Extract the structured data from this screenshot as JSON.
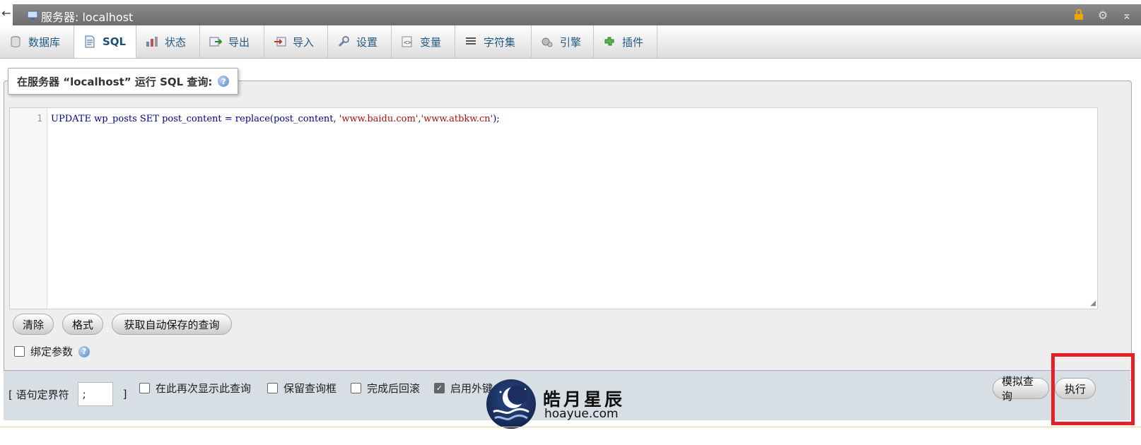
{
  "titlebar": {
    "back_icon": "←",
    "title": "服务器: localhost"
  },
  "tabs": [
    {
      "label": "数据库",
      "icon": "database-icon"
    },
    {
      "label": "SQL",
      "icon": "sql-icon",
      "active": true
    },
    {
      "label": "状态",
      "icon": "status-icon"
    },
    {
      "label": "导出",
      "icon": "export-icon"
    },
    {
      "label": "导入",
      "icon": "import-icon"
    },
    {
      "label": "设置",
      "icon": "wrench-icon"
    },
    {
      "label": "变量",
      "icon": "variables-icon"
    },
    {
      "label": "字符集",
      "icon": "charset-icon"
    },
    {
      "label": "引擎",
      "icon": "engine-icon"
    },
    {
      "label": "插件",
      "icon": "plugin-icon"
    }
  ],
  "query": {
    "legend": "在服务器 “localhost” 运行 SQL 查询:",
    "line_number": "1",
    "code_prefix": "UPDATE wp_posts SET post_content = replace(post_content, ",
    "code_str1": "'www.baidu.com'",
    "code_comma": ",",
    "code_str2": "'www.atbkw.cn'",
    "code_suffix": ");"
  },
  "buttons": {
    "clear": "清除",
    "format": "格式",
    "get_autosaved": "获取自动保存的查询"
  },
  "bind_params": "绑定参数",
  "footer": {
    "delimiter_open": "[ 语句定界符",
    "delimiter_value": ";",
    "delimiter_close": "]",
    "show_again": "在此再次显示此查询",
    "keep_box": "保留查询框",
    "rollback": "完成后回滚",
    "foreign_keys": "启用外键",
    "simulate": "模拟查询",
    "go": "执行"
  },
  "watermark": {
    "cn": "皓月星辰",
    "en": "hoayue.com"
  }
}
